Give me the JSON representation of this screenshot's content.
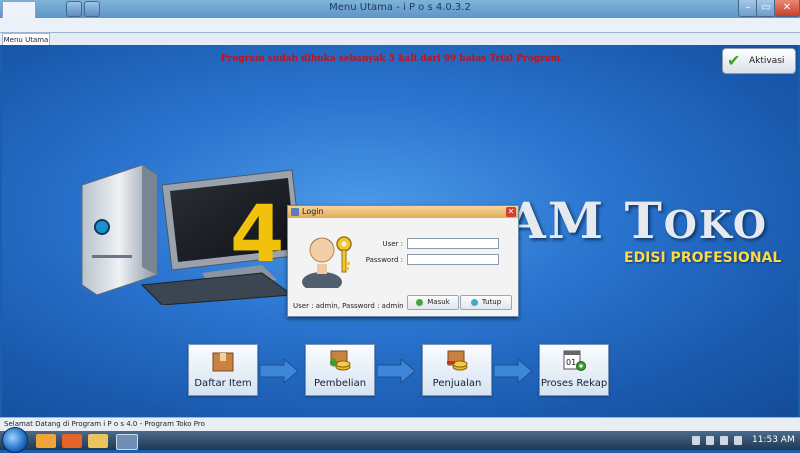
{
  "window": {
    "title": "Menu Utama - i P o s 4.0.3.2",
    "minimize": "–",
    "maximize": "▭",
    "close": "✕"
  },
  "tabs": [
    {
      "label": "Menu Utama"
    }
  ],
  "main": {
    "trial_notice": "Program sudah dibuka sebanyak 5 kali dari 99 batas Trial Program.",
    "aktivasi_label": "Aktivasi",
    "brand_four": "4",
    "brand_text_a": "AM ",
    "brand_text_b": "T",
    "brand_text_c": "OKO",
    "edition": "EDISI PROFESIONAL"
  },
  "flow": [
    {
      "label": "Daftar Item"
    },
    {
      "label": "Pembelian"
    },
    {
      "label": "Penjualan"
    },
    {
      "label": "Proses Rekap"
    }
  ],
  "login": {
    "title": "Login",
    "close": "✕",
    "user_label": "User :",
    "password_label": "Password :",
    "user_value": "",
    "password_value": "",
    "hint": "User : admin, Password : admin",
    "masuk_label": "Masuk",
    "tutup_label": "Tutup"
  },
  "status": {
    "text": "Selamat Datang di Program i P o s  4.0 - Program Toko Pro"
  },
  "taskbar": {
    "clock": "11:53 AM"
  },
  "colors": {
    "accent": "#2a74cf",
    "trial_text": "#c0101a",
    "edition": "#ffd84a"
  }
}
